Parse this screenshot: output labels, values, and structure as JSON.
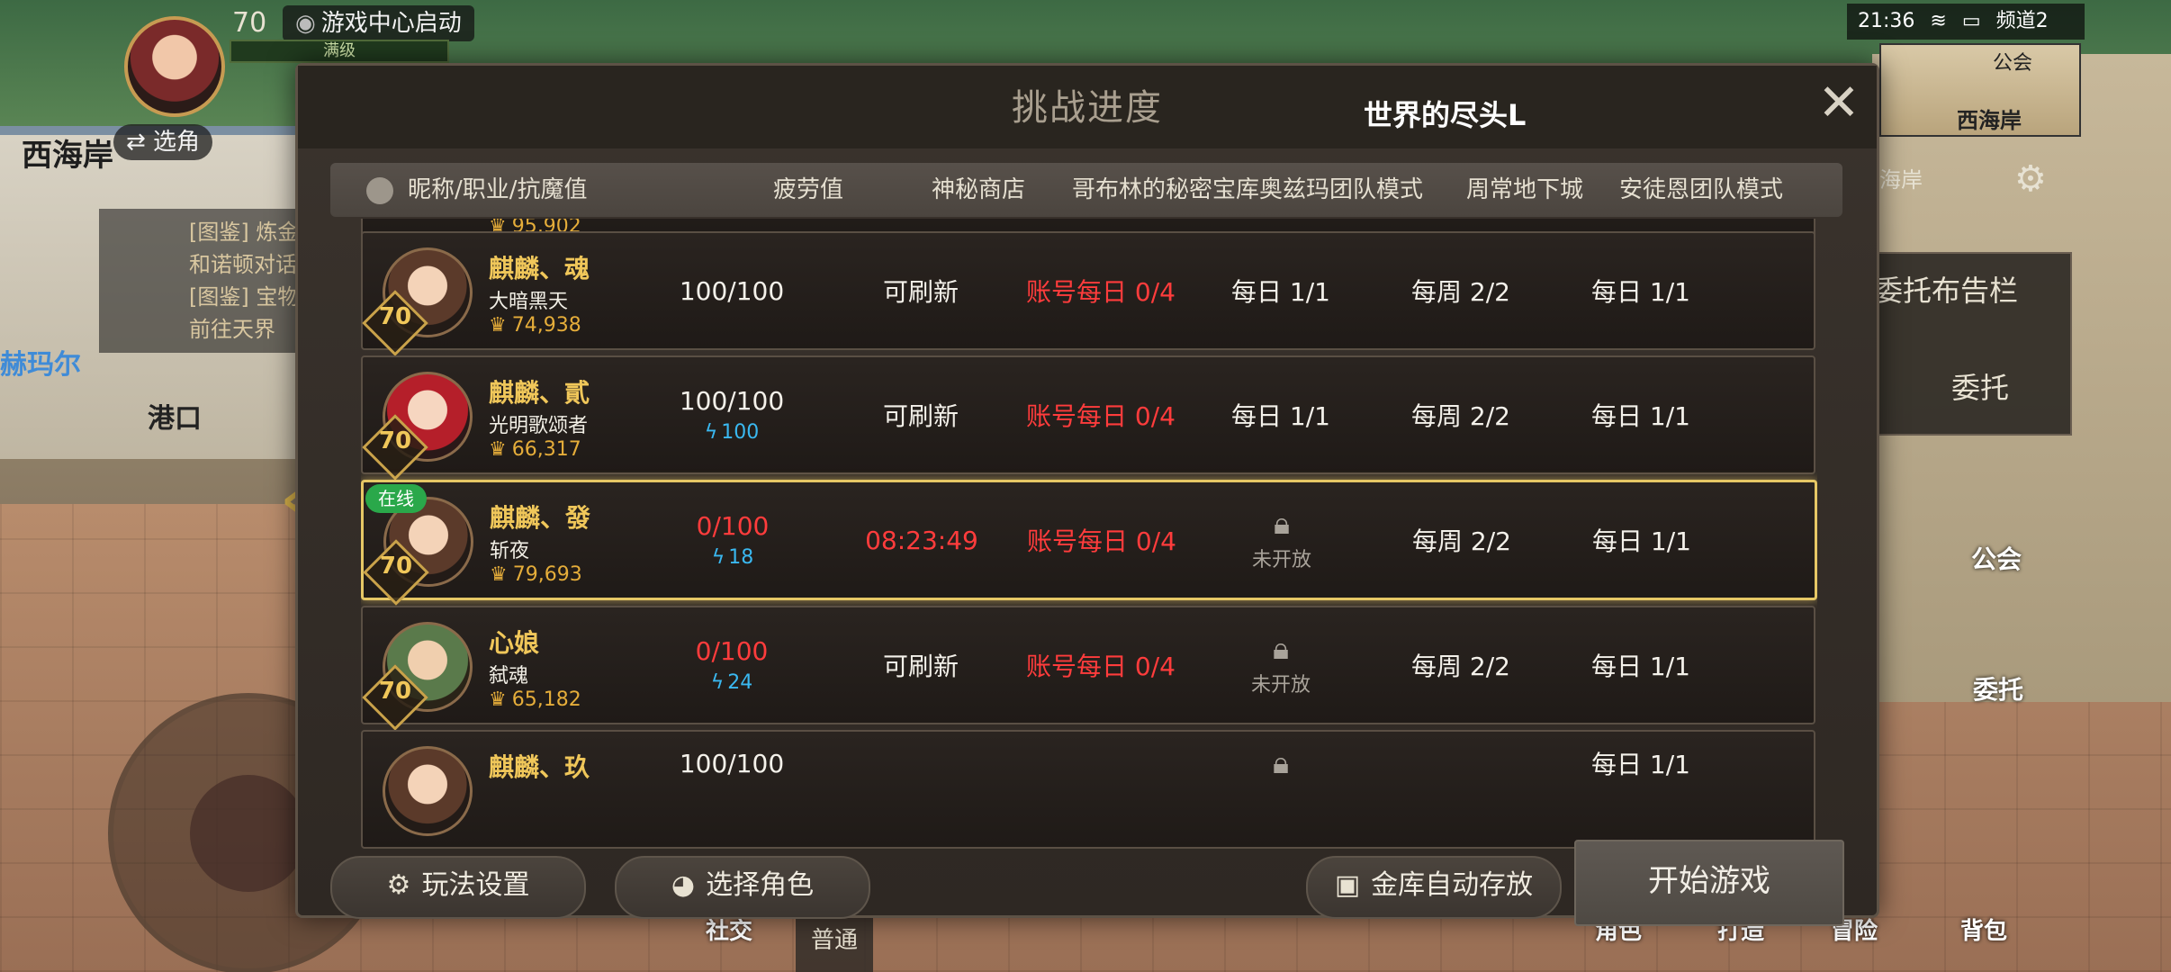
{
  "hud": {
    "level": "70",
    "launch_badge": "游戏中心启动",
    "bar_label": "满级",
    "map_name": "西海岸",
    "swap_button": "⇄ 选角",
    "quests": [
      "[图鉴] 炼金…",
      "和诺顿对话",
      "[图鉴] 宝物…",
      "前往天界"
    ],
    "port_label": "港口",
    "left_side_label": "赫玛尔",
    "status": {
      "time": "21:36",
      "channel": "频道2"
    },
    "minimap_label": "西海岸",
    "minimap_guild": "公会",
    "location_text": "海岸",
    "right_panel": {
      "board": "委托布告栏",
      "commission": "委托"
    },
    "guild": "公会",
    "commission": "委托",
    "bottom": {
      "social": "社交",
      "normal": "普通",
      "character": "角色",
      "craft": "打造",
      "adventure": "冒险",
      "bag": "背包"
    }
  },
  "modal": {
    "title": "挑战进度",
    "server": "世界的尽头L",
    "columns": {
      "name": "昵称/职业/抗魔值",
      "fatigue": "疲劳值",
      "shop": "神秘商店",
      "goblin": "哥布林的秘密宝库",
      "ozma": "奥兹玛团队模式",
      "weekly": "周常地下城",
      "anton": "安徒恩团队模式"
    },
    "partial_top_power": "95,902",
    "rows": [
      {
        "name": "麒麟、魂",
        "job": "大暗黑天",
        "power": "74,938",
        "level": "70",
        "fatigue": "100/100",
        "fatigue_extra": "",
        "shop": "可刷新",
        "goblin": "账号每日 0/4",
        "ozma": "每日 1/1",
        "weekly": "每周 2/2",
        "anton": "每日 1/1"
      },
      {
        "name": "麒麟、貳",
        "job": "光明歌颂者",
        "power": "66,317",
        "level": "70",
        "fatigue": "100/100",
        "fatigue_extra": "100",
        "shop": "可刷新",
        "goblin": "账号每日 0/4",
        "ozma": "每日 1/1",
        "weekly": "每周 2/2",
        "anton": "每日 1/1"
      },
      {
        "name": "麒麟、發",
        "job": "斩夜",
        "power": "79,693",
        "level": "70",
        "online": "在线",
        "fatigue": "0/100",
        "fatigue_extra": "18",
        "shop": "08:23:49",
        "goblin": "账号每日 0/4",
        "ozma": "未开放",
        "weekly": "每周 2/2",
        "anton": "每日 1/1"
      },
      {
        "name": "心娘",
        "job": "弑魂",
        "power": "65,182",
        "level": "70",
        "fatigue": "0/100",
        "fatigue_extra": "24",
        "shop": "可刷新",
        "goblin": "账号每日 0/4",
        "ozma": "未开放",
        "weekly": "每周 2/2",
        "anton": "每日 1/1"
      },
      {
        "name": "麒麟、玖",
        "fatigue": "100/100",
        "anton": "每日 1/1"
      }
    ],
    "footer": {
      "play_settings": "玩法设置",
      "select_character": "选择角色",
      "vault_auto": "金库自动存放",
      "start_game": "开始游戏"
    }
  },
  "colors": {
    "accent_gold": "#f0c75a",
    "alert_red": "#ff3c3c",
    "fatigue_blue": "#3ab8f0",
    "online_green": "#2aa84a",
    "selected_border": "#e6c765"
  }
}
